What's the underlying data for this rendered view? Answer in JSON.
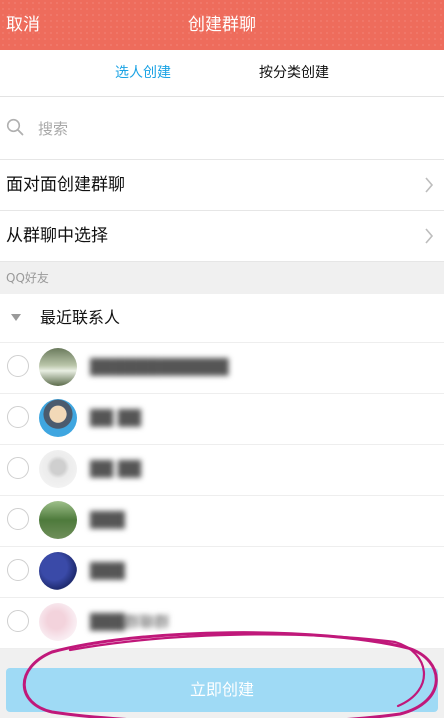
{
  "header": {
    "cancel_label": "取消",
    "title": "创建群聊"
  },
  "tabs": [
    {
      "label": "选人创建",
      "active": true
    },
    {
      "label": "按分类创建",
      "active": false
    }
  ],
  "search": {
    "placeholder": "搜索"
  },
  "menu": [
    {
      "label": "面对面创建群聊"
    },
    {
      "label": "从群聊中选择"
    }
  ],
  "section_label": "QQ好友",
  "group": {
    "label": "最近联系人",
    "expanded": true
  },
  "contacts": [
    {
      "name": "████████████",
      "avatar": "landscape-avatar"
    },
    {
      "name": "██ ██",
      "avatar": "cartoon-avatar"
    },
    {
      "name": "██ ██",
      "avatar": "sketch-avatar"
    },
    {
      "name": "███",
      "avatar": "nature-avatar"
    },
    {
      "name": "███",
      "avatar": "dark-avatar"
    },
    {
      "name": "███群聊群",
      "avatar": "pink-avatar"
    }
  ],
  "create_button": {
    "label": "立即创建",
    "enabled": false
  },
  "colors": {
    "header_bg": "#ee6c5c",
    "accent": "#1ba3e4",
    "button_disabled": "#9fdaf5",
    "annotation": "#c0187a"
  }
}
